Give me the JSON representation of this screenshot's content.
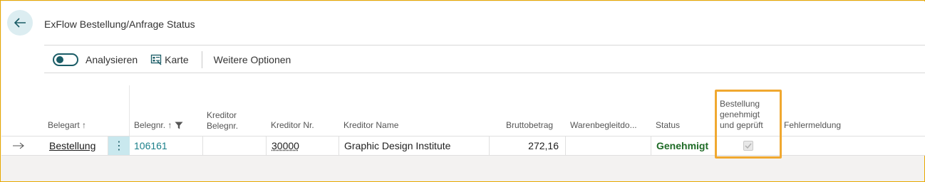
{
  "page": {
    "title": "ExFlow Bestellung/Anfrage Status"
  },
  "actions": {
    "analyze_label": "Analysieren",
    "card_label": "Karte",
    "more_options_label": "Weitere Optionen"
  },
  "table": {
    "headers": {
      "belegart": "Belegart ↑",
      "belegnr": "Belegnr. ↑",
      "kreditor_belegnr_1": "Kreditor",
      "kreditor_belegnr_2": "Belegnr.",
      "kreditor_nr": "Kreditor Nr.",
      "kreditor_name": "Kreditor Name",
      "bruttobetrag": "Bruttobetrag",
      "warenbegleit": "Warenbegleitdo...",
      "status": "Status",
      "genehmigt_1": "Bestellung",
      "genehmigt_2": "genehmigt",
      "genehmigt_3": "und geprüft",
      "fehlermeldung": "Fehlermeldung"
    },
    "rows": [
      {
        "belegart": "Bestellung",
        "belegnr": "106161",
        "kreditor_belegnr": "",
        "kreditor_nr": "30000",
        "kreditor_name": "Graphic Design Institute",
        "bruttobetrag": "272,16",
        "warenbegleit": "",
        "status": "Genehmigt",
        "genehmigt_checked": true,
        "fehlermeldung": ""
      }
    ]
  },
  "colors": {
    "accent": "#1a5c66",
    "highlight": "#f0a830",
    "status_ok": "#1e6b26",
    "link_teal": "#1a7f89"
  }
}
